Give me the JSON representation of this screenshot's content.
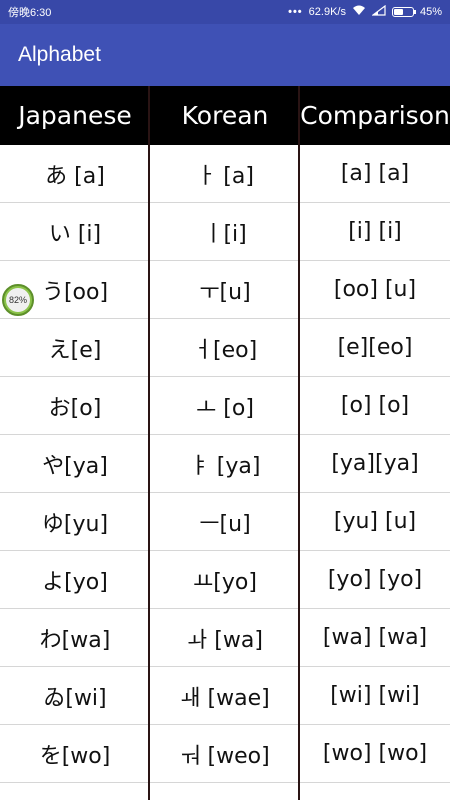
{
  "status_bar": {
    "carrier": "傍晚6:30",
    "dots": "•••",
    "network_speed": "62.9K/s",
    "battery_percent": "45%",
    "icons": [
      "wifi-icon",
      "signal-icon",
      "battery-icon"
    ]
  },
  "app_bar": {
    "title": "Alphabet"
  },
  "table": {
    "headers": [
      "Japanese",
      "Korean",
      "Comparison"
    ],
    "rows": [
      [
        "あ [a]",
        "ㅏ [a]",
        "[a] [a]"
      ],
      [
        "い  [i]",
        "ㅣ[i]",
        "[i] [i]"
      ],
      [
        "う[oo]",
        "ㅜ[u]",
        "[oo]  [u]"
      ],
      [
        "え[e]",
        "ㅓ[eo]",
        "[e][eo]"
      ],
      [
        "お[o]",
        "ㅗ  [o]",
        "[o] [o]"
      ],
      [
        "や[ya]",
        "ㅑ [ya]",
        "[ya][ya]"
      ],
      [
        "ゆ[yu]",
        "ㅡ[u]",
        "[yu] [u]"
      ],
      [
        "よ[yo]",
        "ㅛ[yo]",
        "[yo] [yo]"
      ],
      [
        "わ[wa]",
        "ㅘ [wa]",
        "[wa]  [wa]"
      ],
      [
        "ゐ[wi]",
        "ㅙ  [wae]",
        "[wi] [wi]"
      ],
      [
        "を[wo]",
        "ㅝ [weo]",
        "[wo]  [wo]"
      ]
    ]
  },
  "float_badge": {
    "label": "82%"
  },
  "colors": {
    "status_bar": "#3848a8",
    "app_bar": "#3f51b5",
    "header": "#000000"
  }
}
